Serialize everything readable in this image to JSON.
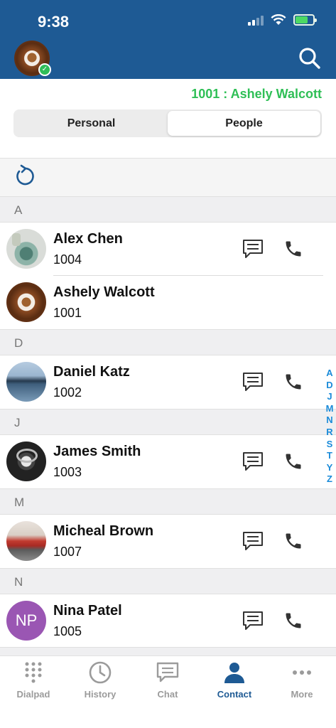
{
  "status_bar": {
    "time": "9:38"
  },
  "header": {
    "search_icon": "search-icon"
  },
  "account": {
    "label": "1001 : Ashely Walcott"
  },
  "segment": {
    "tabs": [
      "Personal",
      "People"
    ],
    "active": "People"
  },
  "sections": [
    {
      "letter": "A"
    },
    {
      "letter": "D"
    },
    {
      "letter": "J"
    },
    {
      "letter": "M"
    },
    {
      "letter": "N"
    }
  ],
  "contacts": [
    {
      "name": "Alex Chen",
      "ext": "1004"
    },
    {
      "name": "Ashely Walcott",
      "ext": "1001"
    },
    {
      "name": "Daniel Katz",
      "ext": "1002"
    },
    {
      "name": "James Smith",
      "ext": "1003"
    },
    {
      "name": "Micheal Brown",
      "ext": "1007"
    },
    {
      "name": "Nina Patel",
      "ext": "1005",
      "initials": "NP"
    }
  ],
  "alpha_index": [
    "A",
    "D",
    "J",
    "M",
    "N",
    "R",
    "S",
    "T",
    "Y",
    "Z"
  ],
  "tabbar": {
    "items": [
      "Dialpad",
      "History",
      "Chat",
      "Contact",
      "More"
    ],
    "active": "Contact"
  },
  "colors": {
    "header": "#1e5a94",
    "accent": "#2fbf56",
    "index": "#1a8bd9",
    "active_tab": "#1e5a94"
  }
}
